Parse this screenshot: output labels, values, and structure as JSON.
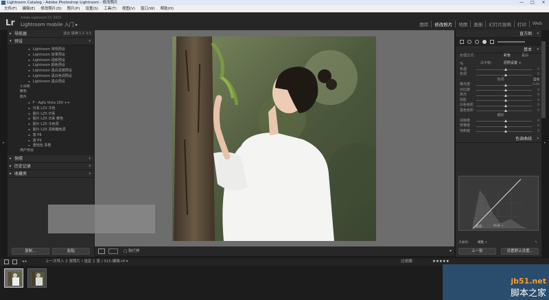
{
  "titlebar": {
    "title": "Lightroom Catalog - Adobe Photoshop Lightroom - 修改照片",
    "min": "—",
    "max": "□",
    "close": "×"
  },
  "menubar": [
    "文件(F)",
    "编辑(E)",
    "修改照片(D)",
    "照片(P)",
    "设置(S)",
    "工具(T)",
    "视图(V)",
    "窗口(W)",
    "帮助(H)"
  ],
  "identity": {
    "logo": "Lr",
    "catalog": "Adobe Lightroom CC 2015",
    "mobile": "Lightroom mobile 入门 ▸"
  },
  "modules": [
    "图库",
    "修改照片",
    "地图",
    "画册",
    "幻灯片放映",
    "打印",
    "Web"
  ],
  "active_module": "修改照片",
  "left": {
    "navigator": {
      "label": "导航器",
      "options": "适合  填满  1:1  3:1"
    },
    "presets": {
      "label": "预设",
      "items": [
        {
          "label": "Lightroom 常规预设",
          "level": "sub"
        },
        {
          "label": "Lightroom 效果预设",
          "level": "sub"
        },
        {
          "label": "Lightroom 视频预设",
          "level": "sub"
        },
        {
          "label": "Lightroom 颜色预设",
          "level": "sub"
        },
        {
          "label": "Lightroom 黑白滤镜预设",
          "level": "sub"
        },
        {
          "label": "Lightroom 黑白色调预设",
          "level": "sub"
        },
        {
          "label": "Lightroom 黑白预设",
          "level": "sub"
        },
        {
          "label": "小清新",
          "level": "top"
        },
        {
          "label": "暖色",
          "level": "top"
        },
        {
          "label": "胶片",
          "level": "top"
        },
        {
          "label": "F - Agfa Vista 100 ++",
          "level": "sub"
        },
        {
          "label": "日系 LZX 冷色",
          "level": "sub"
        },
        {
          "label": "胶片 LZX 日系",
          "level": "sub"
        },
        {
          "label": "胶片 LZX 日系 暖色",
          "level": "sub"
        },
        {
          "label": "胶片 LZX 冷色调",
          "level": "sub"
        },
        {
          "label": "胶片 LZX 清新糖色调",
          "level": "sub"
        },
        {
          "label": "富 P8",
          "level": "sub"
        },
        {
          "label": "富 P9",
          "level": "sub"
        },
        {
          "label": "蜜恰恰 青橙",
          "level": "sub"
        },
        {
          "label": "用户预设",
          "level": "top"
        }
      ]
    },
    "snapshots": "快照",
    "history": "历史记录",
    "collections": "收藏夹",
    "copy_button": "复制...",
    "paste_button": "粘贴"
  },
  "toolbar": {
    "soft_proof": "软打样"
  },
  "right": {
    "histogram": "直方图",
    "basic": "基本",
    "treatment_label": "处理方式：",
    "treatment_color": "彩色",
    "treatment_bw": "黑白",
    "wb_label": "白平衡：",
    "wb_value": "原照设置 ÷",
    "rows": [
      {
        "label": "色温",
        "value": "0",
        "pos": 0.5
      },
      {
        "label": "色调",
        "value": "0",
        "pos": 0.5
      },
      {
        "label": "曝光度",
        "value": "0.00",
        "pos": 0.5
      },
      {
        "label": "对比度",
        "value": "0",
        "pos": 0.5
      },
      {
        "label": "高光",
        "value": "0",
        "pos": 0.5
      },
      {
        "label": "阴影",
        "value": "0",
        "pos": 0.5
      },
      {
        "label": "白色色阶",
        "value": "0",
        "pos": 0.5
      },
      {
        "label": "黑色色阶",
        "value": "0",
        "pos": 0.5
      },
      {
        "label": "清晰度",
        "value": "0",
        "pos": 0.5
      },
      {
        "label": "鲜艳度",
        "value": "0",
        "pos": 0.5
      },
      {
        "label": "饱和度",
        "value": "0",
        "pos": 0.5
      }
    ],
    "tone_label": "色调",
    "tone_auto": "自动",
    "presence_label": "偏好",
    "tone_curve": "色调曲线",
    "channel_label": "通道：",
    "channel_value": "RGB ÷",
    "point_curve_label": "点曲线：",
    "point_curve_value": "线性 ÷",
    "prev_button": "上一张",
    "reset_button": "设置默认设置..."
  },
  "filmbar": {
    "text": "上一次导入  2 张照片 / 选定 1 张 / 315-编辑.tif ▾",
    "filter": "过滤器："
  },
  "watermark": {
    "line1": "jb51.net",
    "line2": "脚本之家"
  }
}
